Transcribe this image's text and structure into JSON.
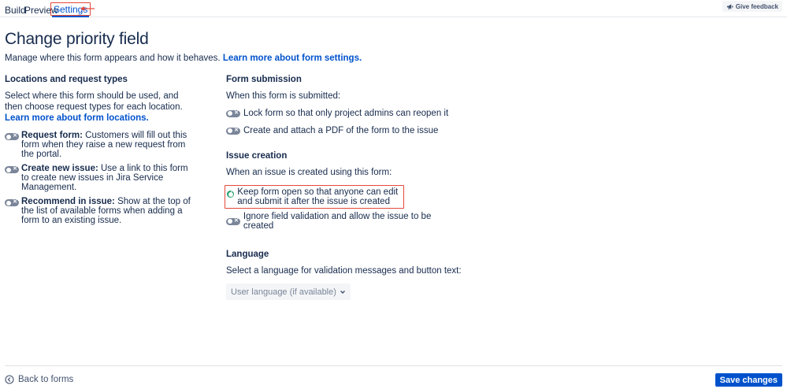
{
  "tabs": [
    {
      "label": "Build"
    },
    {
      "label": "Preview"
    },
    {
      "label": "Settings"
    }
  ],
  "feedback_label": "Give feedback",
  "page_title": "Change priority field",
  "intro": {
    "text": "Manage where this form appears and how it behaves.",
    "link": "Learn more about form settings."
  },
  "locations": {
    "title": "Locations and request types",
    "desc": "Select where this form should be used, and then choose request types for each location.",
    "desc_link": "Learn more about form locations.",
    "items": [
      {
        "label": "Request form:",
        "text": "Customers will fill out this form when they raise a new request from the portal.",
        "enabled": false
      },
      {
        "label": "Create new issue:",
        "text": "Use a link to this form to create new issues in Jira Service Management.",
        "enabled": false
      },
      {
        "label": "Recommend in issue:",
        "text": "Show at the top of the list of available forms when adding a form to an existing issue.",
        "enabled": false
      }
    ]
  },
  "form_submission": {
    "title": "Form submission",
    "desc": "When this form is submitted:",
    "options": [
      {
        "label": "Lock form so that only project admins can reopen it",
        "enabled": false
      },
      {
        "label": "Create and attach a PDF of the form to the issue",
        "enabled": false
      }
    ]
  },
  "issue_creation": {
    "title": "Issue creation",
    "desc": "When an issue is created using this form:",
    "options": [
      {
        "label": "Keep form open so that anyone can edit and submit it after the issue is created",
        "enabled": true
      },
      {
        "label": "Ignore field validation and allow the issue to be created",
        "enabled": false
      }
    ]
  },
  "language": {
    "title": "Language",
    "desc": "Select a language for validation messages and button text:",
    "selected": "User language (if available)"
  },
  "footer": {
    "back_label": "Back to forms",
    "save_label": "Save changes"
  },
  "colors": {
    "accent": "#0052cc",
    "toggle_on": "#22a06b",
    "toggle_off": "#7a8599",
    "annotation": "#e5483a"
  },
  "icons": {
    "feedback": "megaphone-icon",
    "back": "arrow-left-circle-icon",
    "select": "chevron-down-icon"
  }
}
